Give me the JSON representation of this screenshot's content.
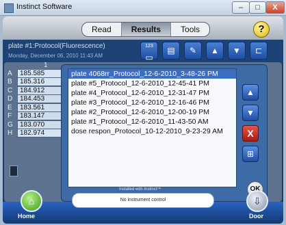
{
  "window": {
    "title": "Instinct Software",
    "minimize": "–",
    "maximize": "□",
    "close": "X"
  },
  "tabs": [
    "Read",
    "Results",
    "Tools"
  ],
  "active_tab": "Results",
  "help_label": "?",
  "info": {
    "plate_title": "plate #1:Protocol(Fluorescence)",
    "date": "Monday, December 06, 2010 11:43 AM"
  },
  "toolbar": {
    "icon123": "123"
  },
  "column_header": "1",
  "rows": [
    {
      "label": "A",
      "value": "185.585"
    },
    {
      "label": "B",
      "value": "185.316"
    },
    {
      "label": "C",
      "value": "184.912"
    },
    {
      "label": "D",
      "value": "184.453"
    },
    {
      "label": "E",
      "value": "183.561"
    },
    {
      "label": "F",
      "value": "183.147"
    },
    {
      "label": "G",
      "value": "183.070"
    },
    {
      "label": "H",
      "value": "182.974"
    }
  ],
  "files": [
    "plate 4068rr_Protocol_12-6-2010_3-48-26 PM",
    "plate #5_Protocol_12-6-2010_12-45-41 PM",
    "plate #4_Protocol_12-6-2010_12-31-47 PM",
    "plate #3_Protocol_12-6-2010_12-16-46 PM",
    "plate #2_Protocol_12-6-2010_12-00-19 PM",
    "plate #1_Protocol_12-6-2010_11-43-50 AM",
    "dose respon_Protocol_10-12-2010_9-23-29 AM"
  ],
  "selected_index": 0,
  "side_buttons": {
    "up": "▲",
    "down": "▼",
    "delete": "X",
    "tree": "⊞"
  },
  "ok_label": "OK",
  "bottom": {
    "home_label": "Home",
    "door_label": "Door",
    "installed": "Installed with Instinct™",
    "status": "No instrument control"
  }
}
